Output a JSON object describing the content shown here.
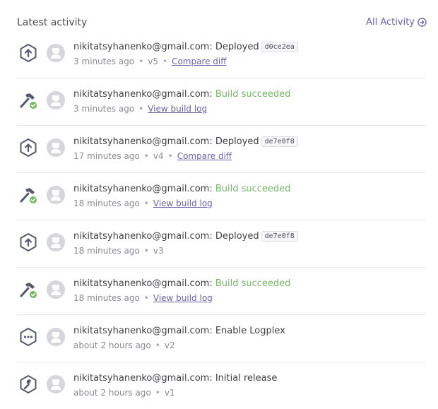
{
  "header": {
    "title": "Latest activity",
    "all_activity_label": "All Activity"
  },
  "colors": {
    "accent": "#6b63a6",
    "success": "#74b566",
    "divider": "#e6e6ea"
  },
  "activities": [
    {
      "type": "deploy",
      "icon": "deploy-icon",
      "email": "nikitatsyhanenko@gmail.com:",
      "message": "Deployed",
      "commit": "d0ce2ea",
      "time": "3 minutes ago",
      "version": "v5",
      "link": "Compare diff"
    },
    {
      "type": "build",
      "icon": "build-success-icon",
      "email": "nikitatsyhanenko@gmail.com:",
      "message": "Build succeeded",
      "commit": "",
      "time": "3 minutes ago",
      "version": "",
      "link": "View build log"
    },
    {
      "type": "deploy",
      "icon": "deploy-icon",
      "email": "nikitatsyhanenko@gmail.com:",
      "message": "Deployed",
      "commit": "de7e0f8",
      "time": "17 minutes ago",
      "version": "v4",
      "link": "Compare diff"
    },
    {
      "type": "build",
      "icon": "build-success-icon",
      "email": "nikitatsyhanenko@gmail.com:",
      "message": "Build succeeded",
      "commit": "",
      "time": "18 minutes ago",
      "version": "",
      "link": "View build log"
    },
    {
      "type": "deploy",
      "icon": "deploy-icon",
      "email": "nikitatsyhanenko@gmail.com:",
      "message": "Deployed",
      "commit": "de7e0f8",
      "time": "18 minutes ago",
      "version": "v3",
      "link": ""
    },
    {
      "type": "build",
      "icon": "build-success-icon",
      "email": "nikitatsyhanenko@gmail.com:",
      "message": "Build succeeded",
      "commit": "",
      "time": "18 minutes ago",
      "version": "",
      "link": "View build log"
    },
    {
      "type": "addon",
      "icon": "more-dots-icon",
      "email": "nikitatsyhanenko@gmail.com:",
      "message": "Enable Logplex",
      "commit": "",
      "time": "about 2 hours ago",
      "version": "v2",
      "link": ""
    },
    {
      "type": "release",
      "icon": "wrench-icon",
      "email": "nikitatsyhanenko@gmail.com:",
      "message": "Initial release",
      "commit": "",
      "time": "about 2 hours ago",
      "version": "v1",
      "link": ""
    }
  ]
}
